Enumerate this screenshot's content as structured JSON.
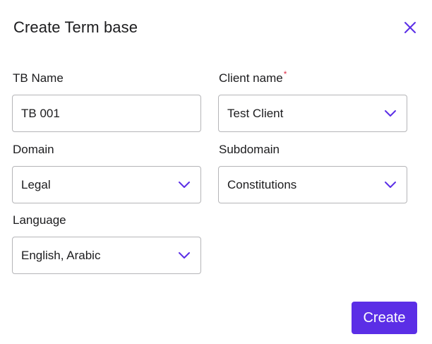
{
  "dialog": {
    "title": "Create Term base",
    "close_icon": "close-icon",
    "accent_color": "#5b2ee6",
    "required_marker_color": "#e0314b"
  },
  "form": {
    "tb_name": {
      "label": "TB Name",
      "value": "TB 001"
    },
    "client_name": {
      "label": "Client name",
      "required_marker": "*",
      "value": "Test Client"
    },
    "domain": {
      "label": "Domain",
      "value": "Legal"
    },
    "subdomain": {
      "label": "Subdomain",
      "value": "Constitutions"
    },
    "language": {
      "label": "Language",
      "value": "English, Arabic"
    }
  },
  "footer": {
    "create_label": "Create"
  }
}
